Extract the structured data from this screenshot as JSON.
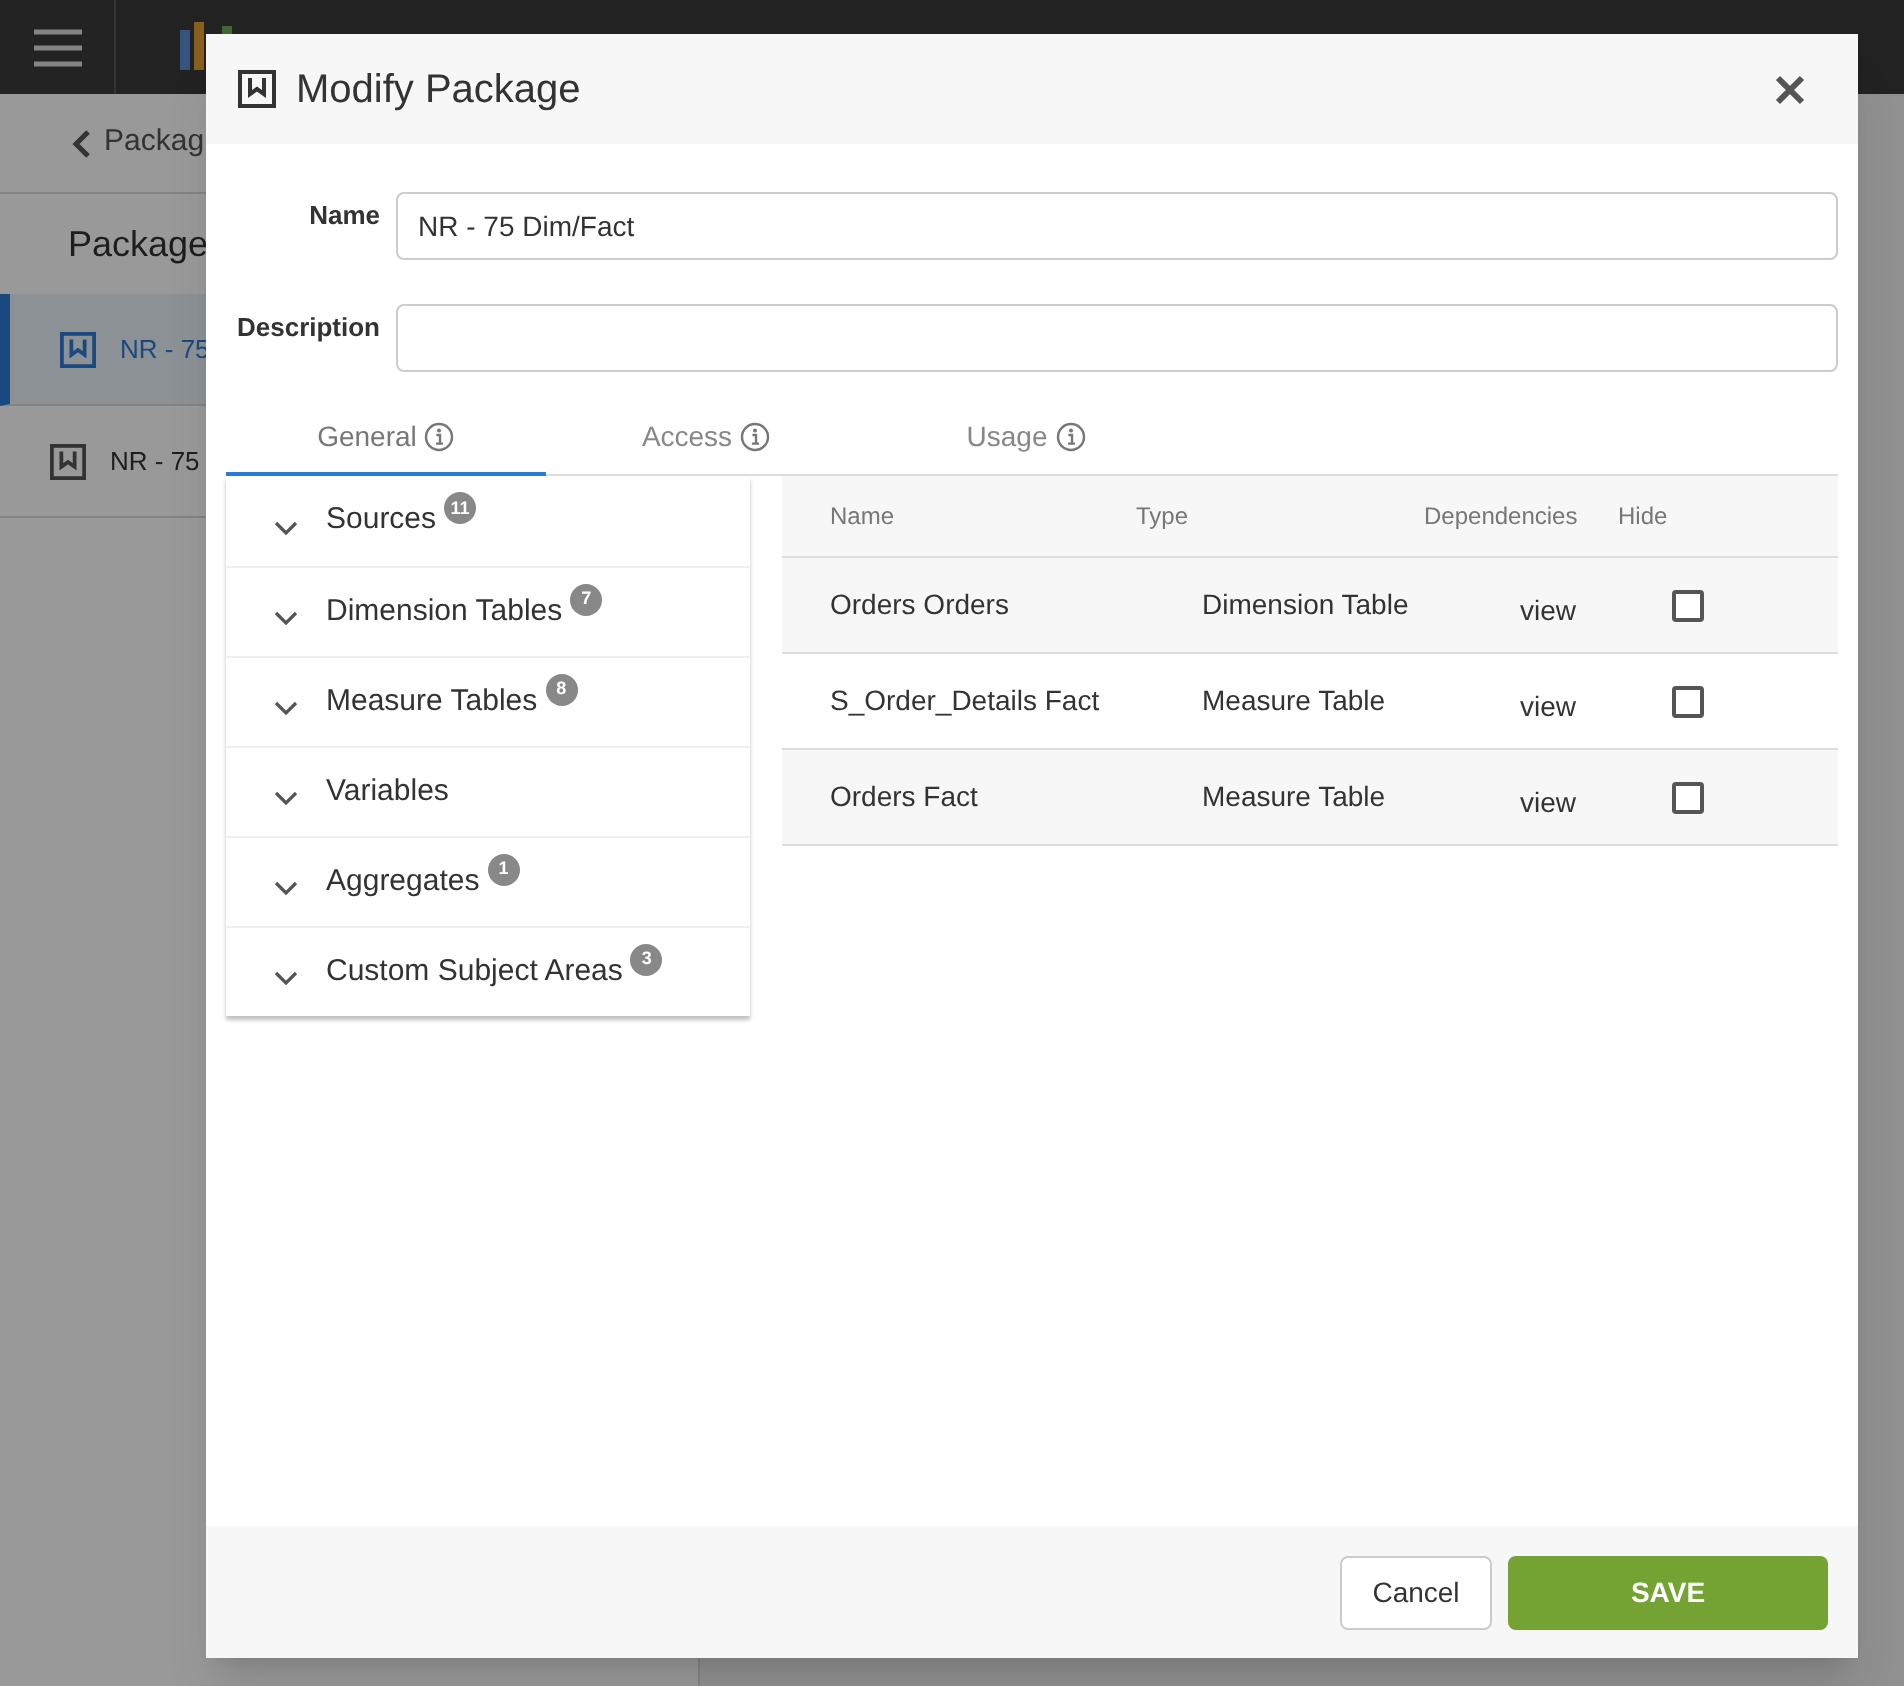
{
  "background": {
    "back_link": "Packag",
    "heading": "Package",
    "items": [
      {
        "label": "NR - 75",
        "selected": true
      },
      {
        "label": "NR - 75",
        "selected": false
      }
    ]
  },
  "dialog": {
    "title": "Modify Package",
    "fields": [
      {
        "label": "Name",
        "value": "NR - 75 Dim/Fact"
      },
      {
        "label": "Description"
      }
    ],
    "tabs": [
      {
        "label": "General",
        "selected": true
      },
      {
        "label": "Access",
        "selected": false
      },
      {
        "label": "Usage",
        "selected": false
      }
    ],
    "sections": [
      {
        "label": "Sources",
        "count": "11"
      },
      {
        "label": "Dimension Tables",
        "count": "7"
      },
      {
        "label": "Measure Tables",
        "count": "8"
      },
      {
        "label": "Variables"
      },
      {
        "label": "Aggregates",
        "count": "1"
      },
      {
        "label": "Custom Subject Areas",
        "count": "3"
      }
    ],
    "table": {
      "columns": [
        "Name",
        "Type",
        "Dependencies",
        "Hide"
      ],
      "rows": [
        {
          "name": "Orders Orders",
          "type": "Dimension Table",
          "dependencies": "view",
          "hidden": false
        },
        {
          "name": "S_Order_Details Fact",
          "type": "Measure Table",
          "dependencies": "view",
          "hidden": false
        },
        {
          "name": "Orders Fact",
          "type": "Measure Table",
          "dependencies": "view",
          "hidden": false
        }
      ]
    },
    "buttons": {
      "cancel": "Cancel",
      "save": "SAVE"
    }
  }
}
